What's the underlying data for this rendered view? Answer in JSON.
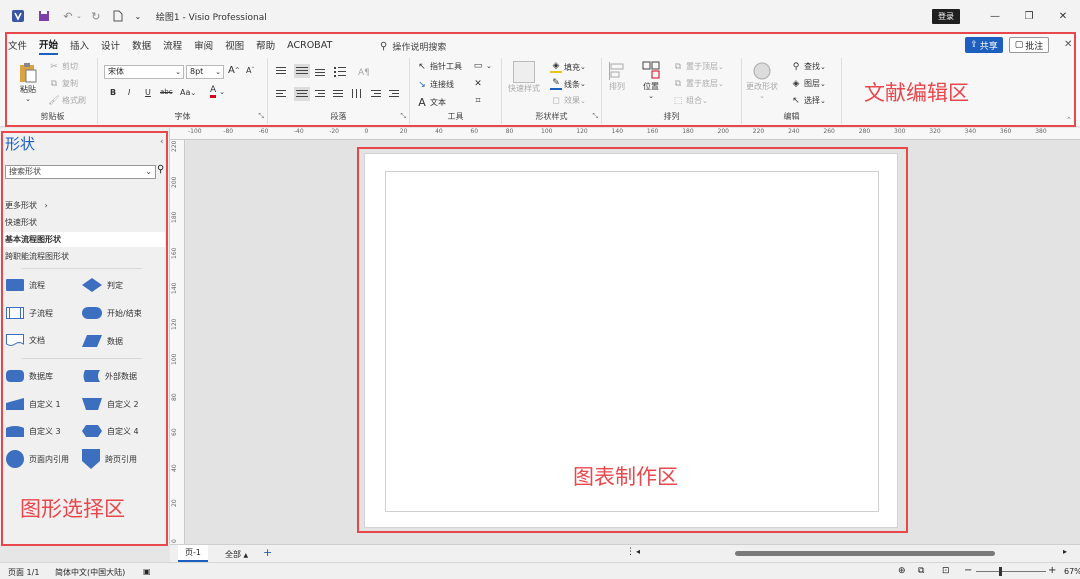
{
  "titlebar": {
    "doc_name": "绘图1",
    "app_name": "Visio Professional",
    "separator": "-",
    "login": "登录"
  },
  "ribbon": {
    "tabs": [
      "文件",
      "开始",
      "插入",
      "设计",
      "数据",
      "流程",
      "审阅",
      "视图",
      "帮助",
      "ACROBAT"
    ],
    "active_tab": "开始",
    "search": "操作说明搜索",
    "share": "共享",
    "comment": "批注",
    "clipboard": {
      "paste": "粘贴",
      "cut": "剪切",
      "copy": "复制",
      "format_painter": "格式刷",
      "label": "剪贴板"
    },
    "font": {
      "family": "宋体",
      "size": "8pt",
      "bold": "B",
      "italic": "I",
      "underline": "U",
      "strike": "abc",
      "case": "Aa",
      "color": "A",
      "grow": "A",
      "shrink": "A",
      "label": "字体"
    },
    "paragraph": {
      "label": "段落"
    },
    "tools": {
      "pointer": "指针工具",
      "connector": "连接线",
      "text": "文本",
      "label": "工具"
    },
    "shape_styles": {
      "quick": "快速样式",
      "fill": "填充",
      "line": "线条",
      "effects": "效果",
      "label": "形状样式"
    },
    "arrange": {
      "align": "排列",
      "position": "位置",
      "front": "置于顶层",
      "back": "置于底层",
      "group": "组合",
      "label": "排列"
    },
    "editing": {
      "change_shape": "更改形状",
      "find": "查找",
      "layers": "图层",
      "select": "选择",
      "label": "编辑"
    }
  },
  "shapes_panel": {
    "title": "形状",
    "search_placeholder": "搜索形状",
    "stencils": [
      "更多形状",
      "快速形状",
      "基本流程图形状",
      "跨职能流程图形状"
    ],
    "active_stencil": "基本流程图形状",
    "items": [
      {
        "label": "流程",
        "icon": "process-shape-icon"
      },
      {
        "label": "判定",
        "icon": "decision-shape-icon"
      },
      {
        "label": "子流程",
        "icon": "subprocess-shape-icon"
      },
      {
        "label": "开始/结束",
        "icon": "terminator-shape-icon"
      },
      {
        "label": "文档",
        "icon": "document-shape-icon"
      },
      {
        "label": "数据",
        "icon": "data-shape-icon"
      },
      {
        "label": "数据库",
        "icon": "database-shape-icon"
      },
      {
        "label": "外部数据",
        "icon": "external-data-shape-icon"
      },
      {
        "label": "自定义 1",
        "icon": "custom1-shape-icon"
      },
      {
        "label": "自定义 2",
        "icon": "custom2-shape-icon"
      },
      {
        "label": "自定义 3",
        "icon": "custom3-shape-icon"
      },
      {
        "label": "自定义 4",
        "icon": "custom4-shape-icon"
      },
      {
        "label": "页面内引用",
        "icon": "on-page-reference-icon"
      },
      {
        "label": "跨页引用",
        "icon": "off-page-reference-icon"
      }
    ]
  },
  "rulers": {
    "horizontal": [
      "-100",
      "-80",
      "-60",
      "-40",
      "-20",
      "0",
      "20",
      "40",
      "60",
      "80",
      "100",
      "120",
      "140",
      "160",
      "180",
      "200",
      "220",
      "240",
      "260",
      "280",
      "300",
      "320",
      "340",
      "360",
      "380"
    ],
    "vertical": [
      "220",
      "200",
      "180",
      "160",
      "140",
      "120",
      "100",
      "80",
      "60",
      "40",
      "20",
      "0"
    ]
  },
  "pagebar": {
    "page_tab": "页-1",
    "all": "全部"
  },
  "statusbar": {
    "page": "页面 1/1",
    "language": "简体中文(中国大陆)",
    "zoom": "67%"
  },
  "annotations": {
    "ribbon": "文献编辑区",
    "shapes": "图形选择区",
    "canvas": "图表制作区"
  },
  "colors": {
    "accent": "#1d5fbf",
    "annotation": "#e8474c",
    "shape_fill": "#3d6fc0"
  }
}
